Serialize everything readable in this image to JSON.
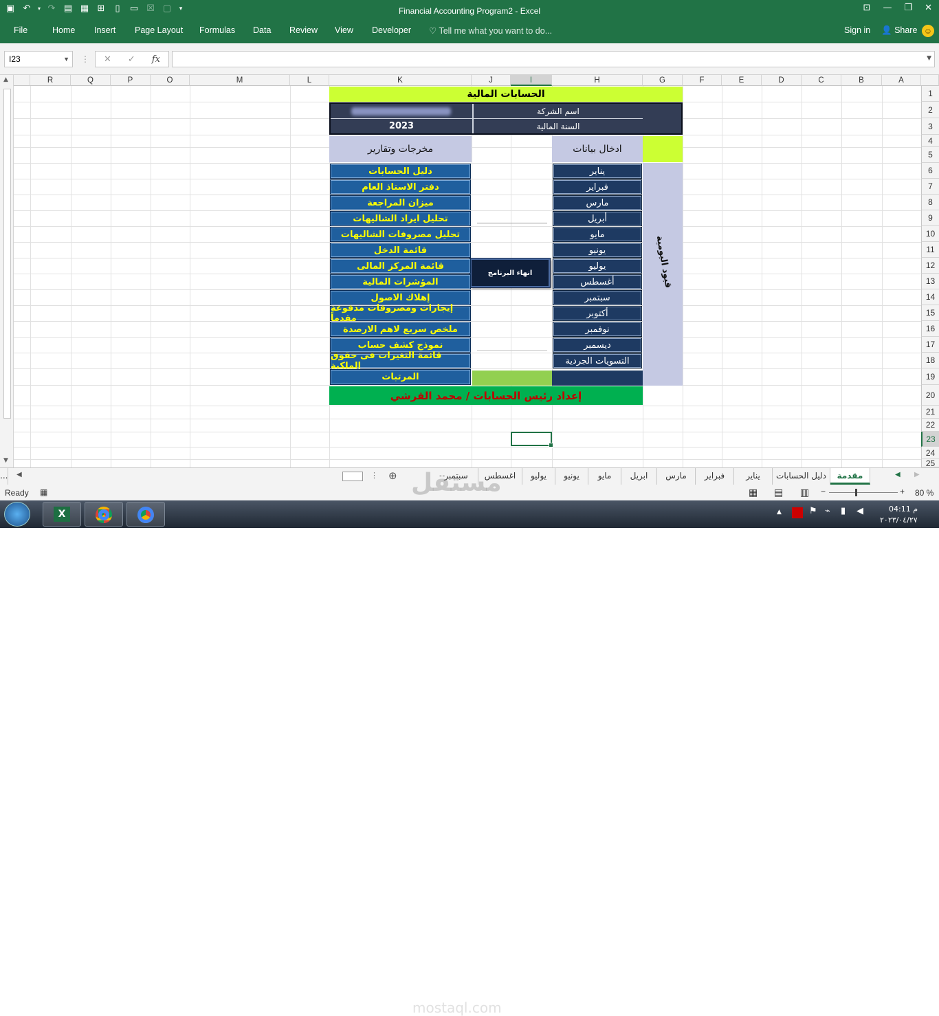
{
  "window": {
    "title": "Financial Accounting Program2 - Excel"
  },
  "ribbon": {
    "tabs": [
      "File",
      "Home",
      "Insert",
      "Page Layout",
      "Formulas",
      "Data",
      "Review",
      "View",
      "Developer"
    ],
    "tell_me": "Tell me what you want to do...",
    "sign_in": "Sign in",
    "share": "Share"
  },
  "formula_bar": {
    "name_box": "I23",
    "fx": "fx",
    "formula": ""
  },
  "columns": [
    "A",
    "B",
    "C",
    "D",
    "E",
    "F",
    "G",
    "H",
    "I",
    "J",
    "K",
    "L",
    "M",
    "O",
    "P",
    "Q",
    "R"
  ],
  "selected_column": "I",
  "rows": [
    "1",
    "2",
    "3",
    "4",
    "5",
    "6",
    "7",
    "8",
    "9",
    "10",
    "11",
    "12",
    "13",
    "14",
    "15",
    "16",
    "17",
    "18",
    "19",
    "20",
    "21",
    "22",
    "23",
    "24",
    "25"
  ],
  "selected_row": "23",
  "sheet": {
    "title": "الحسابات المالية",
    "company_label": "اسم الشركة",
    "fiscal_year_label": "السنة المالية",
    "fiscal_year_value": "2023",
    "outputs_header": "مخرجات وتقارير",
    "inputs_header": "ادخال بيانات",
    "daily_entries": "قيود اليومية",
    "exit_button": "انهاء البرنامج",
    "footer": "إعداد رئيس الحسابات / محمد القرشي",
    "reports": [
      "دليل الحسابات",
      "دفتر الاستاذ العام",
      "ميزان المراجعة",
      "تحليل ايراد الشاليهات",
      "تحليل مصروفات الشاليهات",
      "قائمة الدخل",
      "قائمة المركز المالى",
      "المؤشرات المالية",
      "إهلاك الاصول",
      "إيجارات ومصروفات مدفوعة مقدماً",
      "ملخص سريع لاهم الارصدة",
      "نموذج كشف حساب",
      "قائمة التغيرات فى حقوق الملكية",
      "المرتبات"
    ],
    "months": [
      "يناير",
      "فبراير",
      "مارس",
      "أبريل",
      "مايو",
      "يونيو",
      "يوليو",
      "أغسطس",
      "سبتمبر",
      "أكتوبر",
      "نوفمبر",
      "ديسمبر",
      "التسويات الجردية"
    ]
  },
  "sheet_tabs": [
    "مقدمة",
    "دليل الحسابات",
    "يناير",
    "فبراير",
    "مارس",
    "ابريل",
    "مايو",
    "يونيو",
    "يوليو",
    "اغسطس",
    "سبتمبر",
    "..."
  ],
  "active_tab": "مقدمة",
  "status": {
    "ready": "Ready",
    "zoom": "80 %"
  },
  "taskbar": {
    "time": "04:11 م",
    "date": "٢٠٢٣/٠٤/٢٧"
  },
  "watermark": {
    "brand": "مستقل",
    "site": "mostaql.com"
  },
  "colors": {
    "excel_green": "#217346",
    "title_bg": "#ccff33",
    "report_btn": "#1f5f9e",
    "month_btn": "#1e3a62",
    "footer_bg": "#00b050",
    "footer_text": "#c00000"
  }
}
